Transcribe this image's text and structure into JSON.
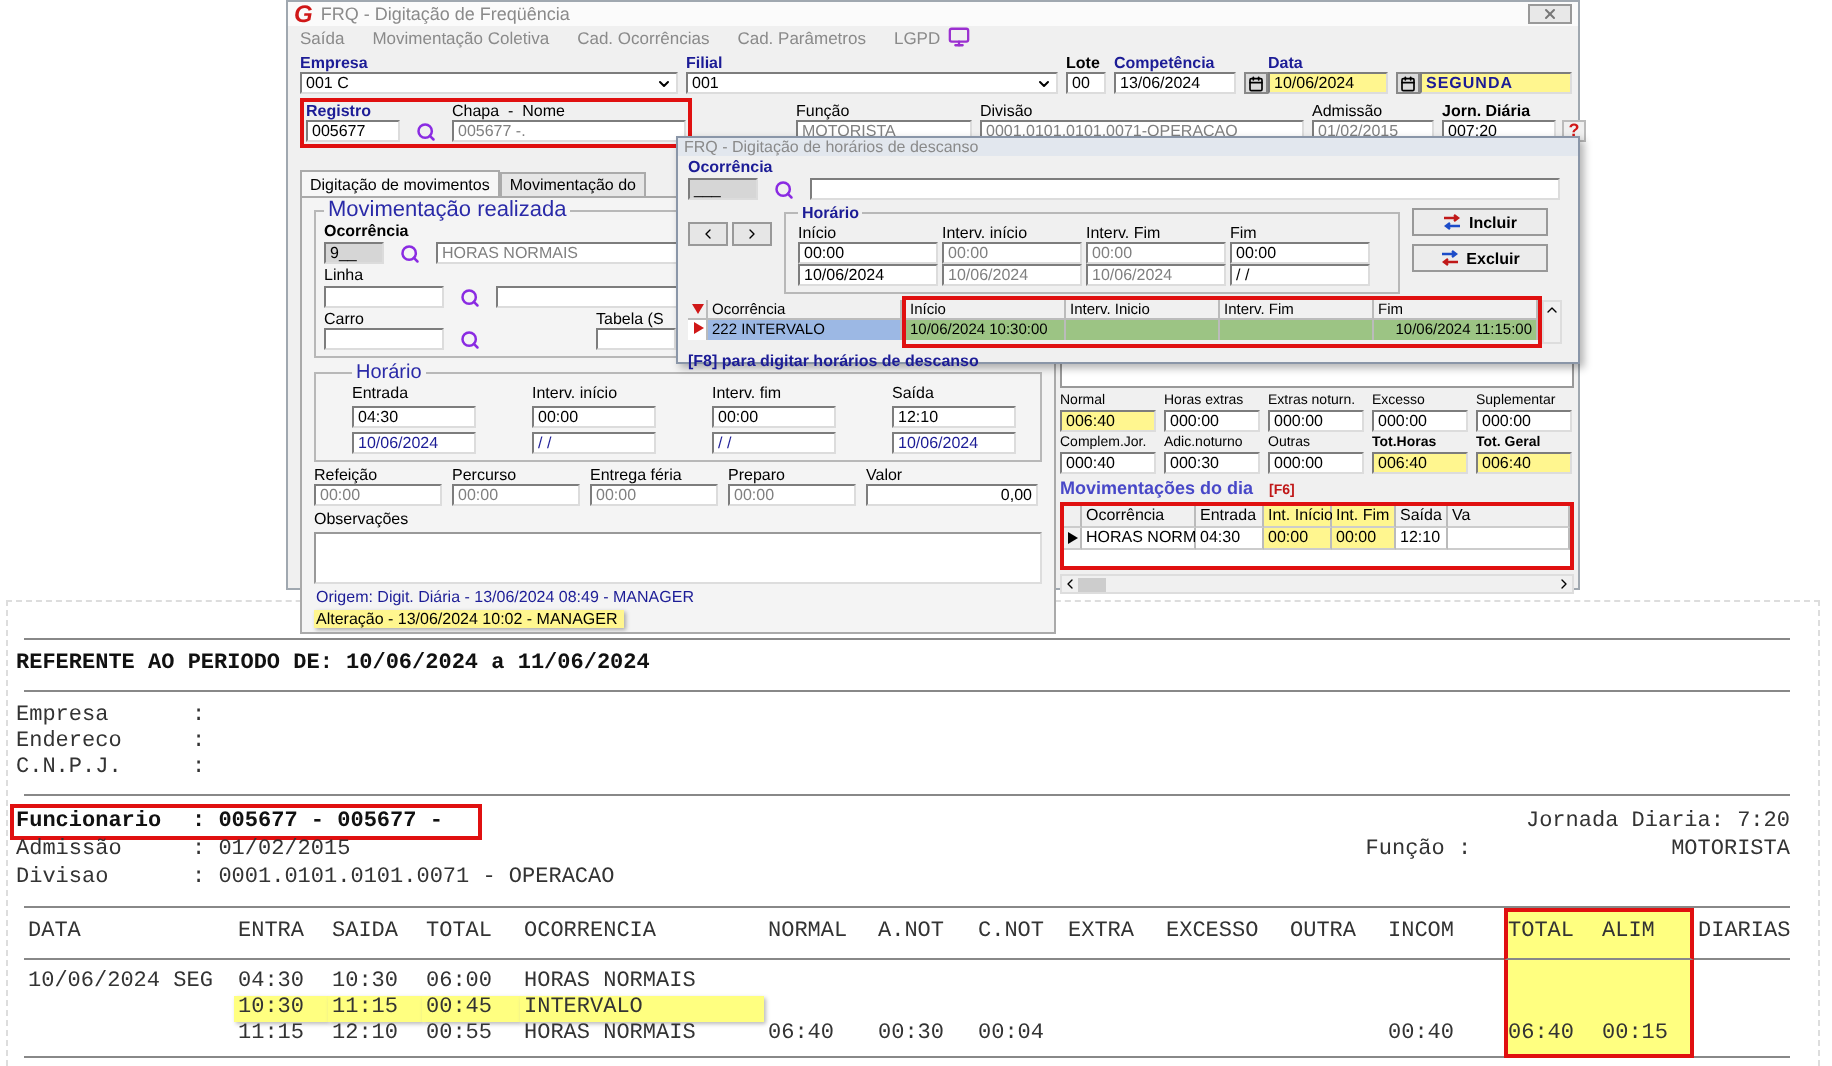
{
  "window": {
    "logo": "G",
    "title": "FRQ - Digitação de Freqüência",
    "menu": [
      "Saída",
      "Movimentação Coletiva",
      "Cad. Ocorrências",
      "Cad. Parâmetros",
      "LGPD"
    ]
  },
  "header_row1": [
    {
      "label": "Empresa",
      "accent": true,
      "value": "001 C",
      "kind": "combo",
      "highlighted": false
    },
    {
      "label": "Filial",
      "accent": true,
      "value": "001",
      "kind": "combo",
      "highlighted": false
    },
    {
      "label": "Lote",
      "accent": false,
      "value": "00",
      "kind": "text",
      "highlighted": false
    },
    {
      "label": "Competência",
      "accent": true,
      "value": "13/06/2024",
      "kind": "date",
      "highlighted": false
    },
    {
      "label": "Data",
      "accent": true,
      "value": "10/06/2024",
      "kind": "date",
      "highlighted": true,
      "weekday": "SEGUNDA"
    }
  ],
  "employee": {
    "annotated": true,
    "registro": {
      "label": "Registro",
      "value": "005677"
    },
    "chapa": {
      "label": "Chapa  -  Nome",
      "value": "005677 -."
    }
  },
  "header_row2": [
    {
      "label": "Função",
      "bold": false,
      "value": "MOTORISTA",
      "disabled": true
    },
    {
      "label": "Divisão",
      "bold": false,
      "value": "0001.0101.0101.0071-OPERACAO",
      "disabled": true
    },
    {
      "label": "Admissão",
      "bold": false,
      "value": "01/02/2015",
      "disabled": true
    },
    {
      "label": "Jorn. Diária",
      "bold": true,
      "value": "007:20",
      "disabled": false,
      "help": "?"
    }
  ],
  "tabs": [
    {
      "label": "Digitação de movimentos",
      "selected": true
    },
    {
      "label": "Movimentação do",
      "selected": false
    }
  ],
  "movement": {
    "title": "Movimentação realizada",
    "ocorrencia": {
      "label": "Ocorrência",
      "code": "9__",
      "name": "HORAS NORMAIS"
    },
    "linha": {
      "label": "Linha"
    },
    "carro": {
      "label": "Carro"
    },
    "tabela": {
      "label": "Tabela (S"
    }
  },
  "schedule": {
    "title": "Horário",
    "columns": [
      {
        "label": "Entrada",
        "time": "04:30",
        "date": "10/06/2024"
      },
      {
        "label": "Interv. início",
        "time": "00:00",
        "date": "/ /"
      },
      {
        "label": "Interv. fim",
        "time": "00:00",
        "date": "/ /"
      },
      {
        "label": "Saída",
        "time": "12:10",
        "date": "10/06/2024"
      }
    ]
  },
  "extras": [
    {
      "label": "Refeição",
      "value": "00:00",
      "kind": "time"
    },
    {
      "label": "Percurso",
      "value": "00:00",
      "kind": "time"
    },
    {
      "label": "Entrega féria",
      "value": "00:00",
      "kind": "time"
    },
    {
      "label": "Preparo",
      "value": "00:00",
      "kind": "time"
    },
    {
      "label": "Valor",
      "value": "0,00",
      "kind": "money"
    }
  ],
  "notes": {
    "label": "Observações"
  },
  "audit": [
    {
      "text": "Origem: Digit. Diária - 13/06/2024 08:49 - MANAGER",
      "highlighted": false
    },
    {
      "text": "Alteração - 13/06/2024 10:02 - MANAGER",
      "highlighted": true
    }
  ],
  "totals": [
    {
      "label": "Normal",
      "value": "006:40",
      "highlighted": true,
      "bold": false
    },
    {
      "label": "Horas extras",
      "value": "000:00",
      "highlighted": false,
      "bold": false
    },
    {
      "label": "Extras noturn.",
      "value": "000:00",
      "highlighted": false,
      "bold": false
    },
    {
      "label": "Excesso",
      "value": "000:00",
      "highlighted": false,
      "bold": false
    },
    {
      "label": "Suplementar",
      "value": "000:00",
      "highlighted": false,
      "bold": false
    },
    {
      "label": "Complem.Jor.",
      "value": "000:40",
      "highlighted": false,
      "bold": false
    },
    {
      "label": "Adic.noturno",
      "value": "000:30",
      "highlighted": false,
      "bold": false
    },
    {
      "label": "Outras",
      "value": "000:00",
      "highlighted": false,
      "bold": false
    },
    {
      "label": "Tot.Horas",
      "value": "006:40",
      "highlighted": true,
      "bold": true
    },
    {
      "label": "Tot. Geral",
      "value": "006:40",
      "highlighted": true,
      "bold": true
    }
  ],
  "day_movements": {
    "title": "Movimentações do dia",
    "shortcut": "[F6]",
    "annotated": true,
    "columns": [
      {
        "label": "Ocorrência",
        "highlighted": false
      },
      {
        "label": "Entrada",
        "highlighted": false
      },
      {
        "label": "Int. Início",
        "highlighted": true
      },
      {
        "label": "Int. Fim",
        "highlighted": true
      },
      {
        "label": "Saída",
        "highlighted": false
      },
      {
        "label": "Va",
        "highlighted": false
      }
    ],
    "rows": [
      {
        "current": true,
        "cells": [
          "HORAS NORM",
          "04:30",
          "00:00",
          "00:00",
          "12:10"
        ]
      }
    ]
  },
  "dialog": {
    "title": "FRQ - Digitação de horários de descanso",
    "ocorrencia": {
      "label": "Ocorrência",
      "value": "___"
    },
    "schedule": {
      "title": "Horário",
      "columns": [
        {
          "label": "Início",
          "time": "00:00",
          "date": "10/06/2024",
          "disabled": false
        },
        {
          "label": "Interv. início",
          "time": "00:00",
          "date": "10/06/2024",
          "disabled": true
        },
        {
          "label": "Interv. Fim",
          "time": "00:00",
          "date": "10/06/2024",
          "disabled": true
        },
        {
          "label": "Fim",
          "time": "00:00",
          "date": "/ /",
          "disabled": false
        }
      ]
    },
    "buttons": [
      {
        "label": "Incluir",
        "kind": "add"
      },
      {
        "label": "Excluir",
        "kind": "remove"
      }
    ],
    "grid": {
      "annotated": true,
      "columns": [
        "Ocorrência",
        "Início",
        "Interv. Inicio",
        "Interv. Fim",
        "Fim"
      ],
      "rows": [
        {
          "selected": true,
          "ocorrencia": "222 INTERVALO",
          "inicio": "10/06/2024 10:30:00",
          "fim": "10/06/2024 11:15:00"
        }
      ]
    },
    "hint": "[F8] para digitar horários de descanso"
  },
  "report": {
    "period": "REFERENTE AO PERIODO DE: 10/06/2024 a 11/06/2024",
    "company": [
      {
        "label": "Empresa",
        "separator": ":"
      },
      {
        "label": "Endereco",
        "separator": ":"
      },
      {
        "label": "C.N.P.J.",
        "separator": ":"
      }
    ],
    "employee": [
      {
        "label": "Funcionario",
        "value": ": 005677 - 005677 -",
        "bold": true,
        "annotated": true,
        "right_label": "Jornada Diaria: 7:20"
      },
      {
        "label": "Admissão",
        "value": ": 01/02/2015",
        "bold": false,
        "annotated": false,
        "right_label": "Função :",
        "right_value": "MOTORISTA"
      },
      {
        "label": "Divisao",
        "value": ": 0001.0101.0101.0071 - OPERACAO",
        "bold": false,
        "annotated": false
      }
    ],
    "columns": [
      {
        "label": "DATA",
        "highlighted": false
      },
      {
        "label": "ENTRA",
        "highlighted": false
      },
      {
        "label": "SAIDA",
        "highlighted": false
      },
      {
        "label": "TOTAL",
        "highlighted": false
      },
      {
        "label": "OCORRENCIA",
        "highlighted": false
      },
      {
        "label": "NORMAL",
        "highlighted": false
      },
      {
        "label": "A.NOT",
        "highlighted": false
      },
      {
        "label": "C.NOT",
        "highlighted": false
      },
      {
        "label": "EXTRA",
        "highlighted": false
      },
      {
        "label": "EXCESSO",
        "highlighted": false
      },
      {
        "label": "OUTRA",
        "highlighted": false
      },
      {
        "label": "INCOM",
        "highlighted": false
      },
      {
        "label": "TOTAL",
        "highlighted": true
      },
      {
        "label": "ALIM",
        "highlighted": true
      },
      {
        "label": "DIARIAS",
        "highlighted": false
      }
    ],
    "rows": [
      {
        "highlighted": false,
        "data": "10/06/2024 SEG",
        "entra": "04:30",
        "saida": "10:30",
        "total": "06:00",
        "ocorrencia": "HORAS NORMAIS"
      },
      {
        "highlighted": true,
        "entra": "10:30",
        "saida": "11:15",
        "total": "00:45",
        "ocorrencia": "INTERVALO"
      },
      {
        "highlighted": false,
        "entra": "11:15",
        "saida": "12:10",
        "total": "00:55",
        "ocorrencia": "HORAS NORMAIS",
        "normal": "06:40",
        "a_not": "00:30",
        "c_not": "00:04",
        "incom": "00:40",
        "total_geral": "06:40",
        "alim": "00:15"
      }
    ]
  }
}
